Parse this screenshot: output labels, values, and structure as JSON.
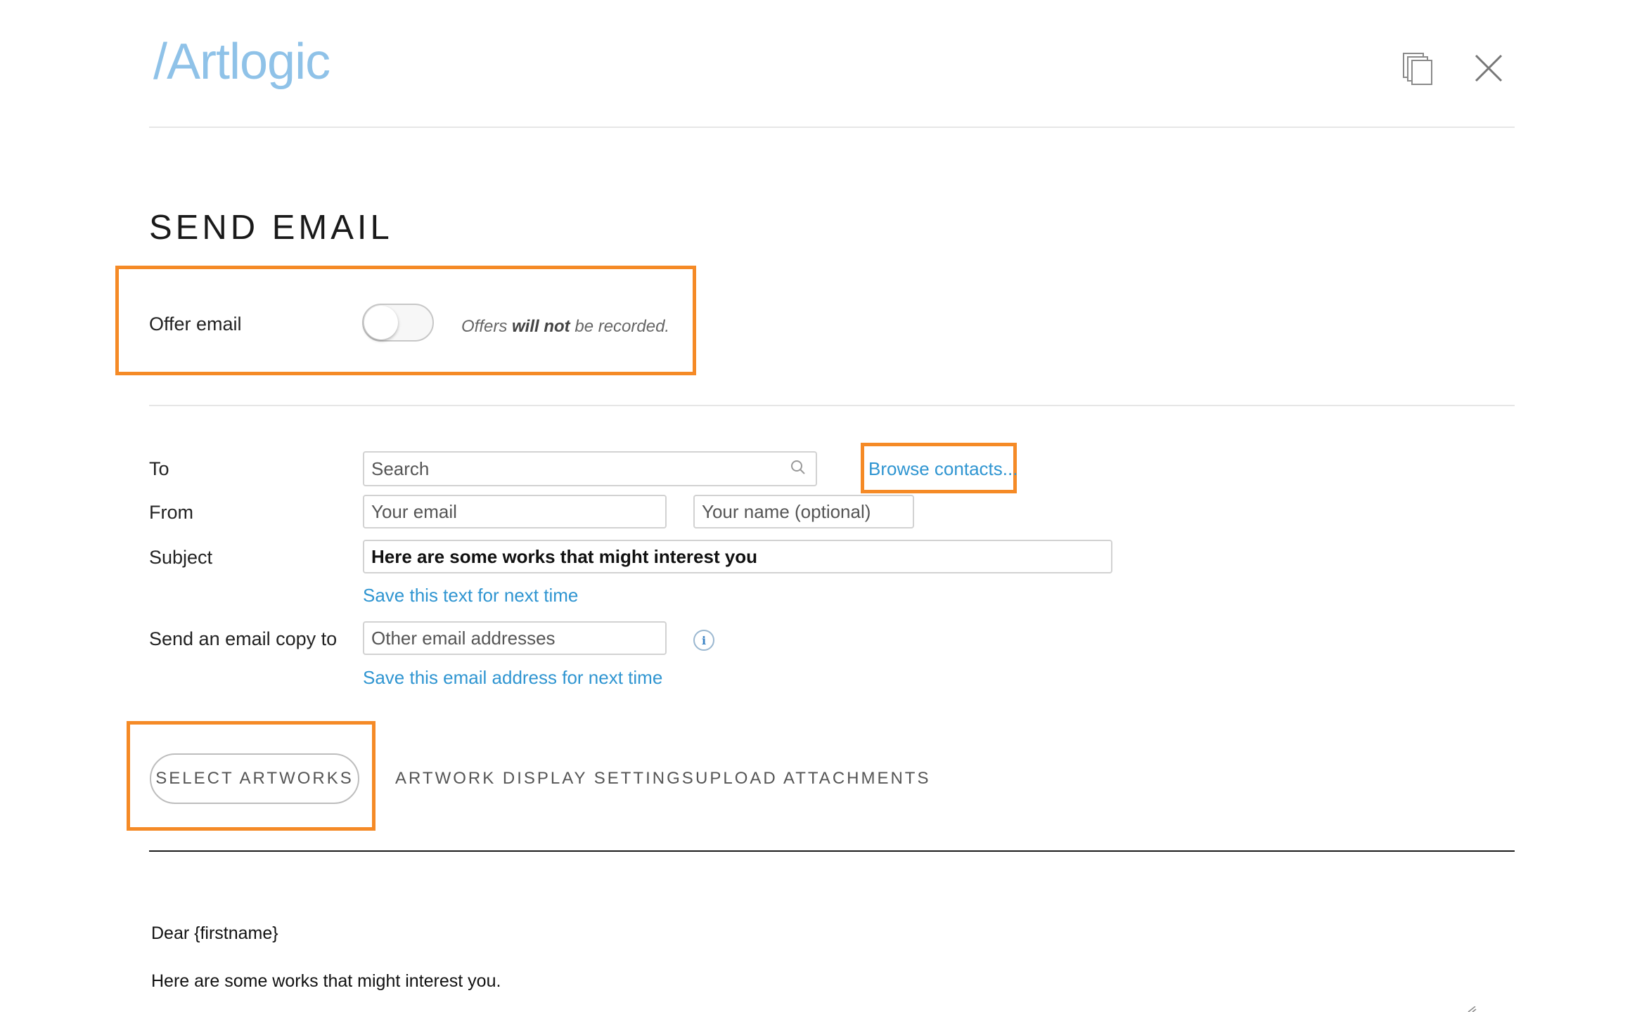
{
  "header": {
    "logo": "/Artlogic",
    "icons": {
      "copy": "copy-icon",
      "close": "close-icon"
    }
  },
  "page": {
    "title": "SEND EMAIL"
  },
  "offer": {
    "label": "Offer email",
    "toggle_on": false,
    "note_prefix": "Offers ",
    "note_bold": "will not",
    "note_suffix": " be recorded."
  },
  "form": {
    "to_label": "To",
    "to_placeholder": "Search",
    "browse_contacts": "Browse contacts...",
    "from_label": "From",
    "from_email_placeholder": "Your email",
    "from_name_placeholder": "Your name (optional)",
    "subject_label": "Subject",
    "subject_value": "Here are some works that might interest you",
    "save_subject": "Save this text for next time",
    "copy_label": "Send an email copy to",
    "copy_placeholder": "Other email addresses",
    "info_icon": "i",
    "save_copy": "Save this email address for next time"
  },
  "tabs": [
    {
      "label": "SELECT ARTWORKS",
      "active": true
    },
    {
      "label": "ARTWORK DISPLAY SETTINGS",
      "active": false
    },
    {
      "label": "UPLOAD ATTACHMENTS",
      "active": false
    }
  ],
  "message": {
    "greeting": "Dear {firstname}",
    "body": "Here are some works that might interest you."
  },
  "colors": {
    "accent": "#2f95d1",
    "highlight": "#f58a26",
    "logo": "#8fc2e8"
  }
}
